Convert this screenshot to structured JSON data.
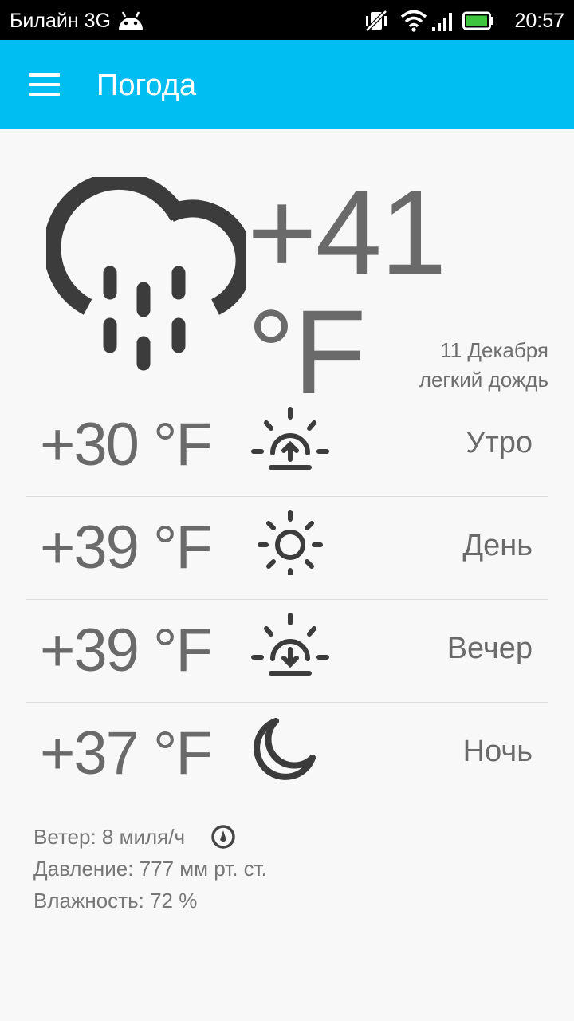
{
  "status_bar": {
    "carrier": "Билайн 3G",
    "time": "20:57",
    "icons": [
      "android-icon",
      "mute-vibrate-icon",
      "wifi-icon",
      "signal-icon",
      "battery-icon"
    ]
  },
  "toolbar": {
    "title": "Погода",
    "menu_icon": "hamburger-menu-icon",
    "background": "#00bdf2"
  },
  "current": {
    "icon": "rain-cloud-icon",
    "temperature": "+41 °F",
    "date": "11 Декабря",
    "condition": "легкий дождь"
  },
  "periods": [
    {
      "temperature": "+30 °F",
      "label": "Утро",
      "icon": "sunrise-icon"
    },
    {
      "temperature": "+39 °F",
      "label": "День",
      "icon": "sun-icon"
    },
    {
      "temperature": "+39 °F",
      "label": "Вечер",
      "icon": "sunset-icon"
    },
    {
      "temperature": "+37 °F",
      "label": "Ночь",
      "icon": "moon-icon"
    }
  ],
  "details": {
    "wind": "Ветер: 8 миля/ч",
    "wind_icon": "wind-direction-icon",
    "pressure": "Давление: 777 мм рт. ст.",
    "humidity": "Влажность: 72 %"
  }
}
